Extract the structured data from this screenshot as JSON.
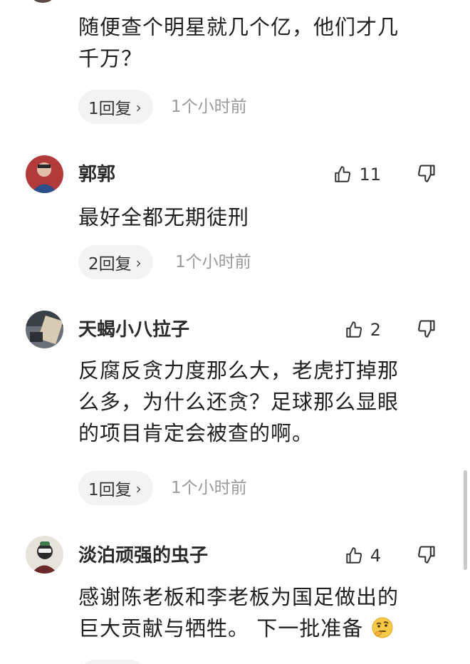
{
  "comments": [
    {
      "text_lines": [
        "随便查个明星就几个亿，他们才几",
        "千万？"
      ],
      "reply_label": "1回复",
      "time": "1个小时前"
    },
    {
      "username": "郭郭",
      "likes": "11",
      "text_lines": [
        "最好全都无期徒刑"
      ],
      "reply_label": "2回复",
      "time": "1个小时前"
    },
    {
      "username": "天蝎小八拉子",
      "likes": "2",
      "text_lines": [
        "反腐反贪力度那么大，老虎打掉那",
        "么多，为什么还贪？足球那么显眼",
        "的项目肯定会被查的啊。"
      ],
      "reply_label": "1回复",
      "time": "1个小时前"
    },
    {
      "username": "淡泊顽强的虫子",
      "likes": "4",
      "text_lines": [
        "感谢陈老板和李老板为国足做出的",
        "巨大贡献与牺牲。 下一批准备"
      ],
      "emoji": "thinking-face"
    }
  ],
  "icons": {
    "like": "thumbs-up-icon",
    "dislike": "thumbs-down-icon",
    "chevron": "chevron-right-icon"
  },
  "colors": {
    "reply_bg": "#f3f3f3",
    "time_text": "#9a9a9a",
    "body_text": "#1f1f1f"
  }
}
